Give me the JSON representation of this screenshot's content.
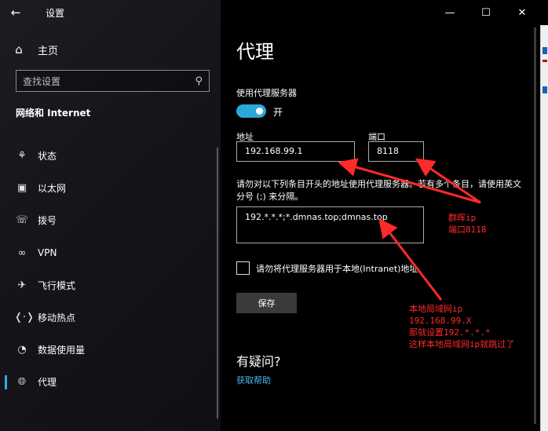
{
  "window": {
    "app_title": "设置",
    "back_icon": "back-arrow-icon",
    "controls": [
      "minimize-icon",
      "maximize-icon",
      "close-icon"
    ]
  },
  "sidebar": {
    "home": {
      "icon": "home-icon",
      "label": "主页"
    },
    "search": {
      "placeholder": "查找设置",
      "icon": "search-icon"
    },
    "section_title": "网络和 Internet",
    "items": [
      {
        "icon": "globe-status-icon",
        "label": "状态"
      },
      {
        "icon": "ethernet-icon",
        "label": "以太网"
      },
      {
        "icon": "dialup-icon",
        "label": "拨号"
      },
      {
        "icon": "vpn-icon",
        "label": "VPN"
      },
      {
        "icon": "airplane-icon",
        "label": "飞行模式"
      },
      {
        "icon": "hotspot-icon",
        "label": "移动热点"
      },
      {
        "icon": "data-usage-icon",
        "label": "数据使用量"
      },
      {
        "icon": "globe-icon",
        "label": "代理",
        "active": true
      }
    ]
  },
  "main": {
    "page_title": "代理",
    "use_proxy_label": "使用代理服务器",
    "toggle_state": "开",
    "address_label": "地址",
    "address_value": "192.168.99.1",
    "port_label": "端口",
    "port_value": "8118",
    "exceptions_desc": "请勿对以下列条目开头的地址使用代理服务器。若有多个条目，请使用英文分号 (;) 来分隔。",
    "exceptions_value": "192.*.*.*;*.dmnas.top;dmnas.top",
    "bypass_local_label": "请勿将代理服务器用于本地(Intranet)地址",
    "bypass_local_checked": false,
    "save_label": "保存",
    "faq_title": "有疑问?",
    "help_link": "获取帮助"
  },
  "annotations": {
    "top_note": "群晖ip\n端口8118",
    "bottom_note": "本地局域网ip\n192.168.99.X\n那就设置192.*.*.*\n这样本地局域网ip就跳过了",
    "color": "#ff2a2a"
  },
  "colors": {
    "accent": "#2aa8d8",
    "link": "#4cb3e8",
    "annotation": "#ff2a2a"
  }
}
